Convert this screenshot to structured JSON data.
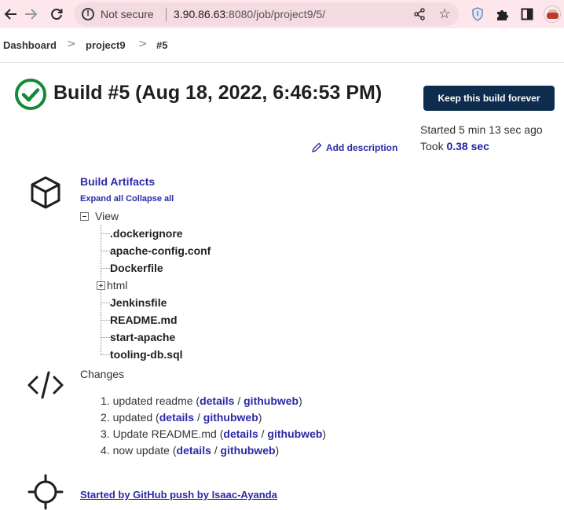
{
  "browser": {
    "security_label": "Not secure",
    "url_host": "3.90.86.63",
    "url_rest": ":8080/job/project9/5/"
  },
  "breadcrumb": {
    "items": [
      "Dashboard",
      "project9",
      "#5"
    ],
    "separator": ">"
  },
  "build": {
    "title": "Build #5 (Aug 18, 2022, 6:46:53 PM)",
    "status": "success",
    "keep_button_label": "Keep this build forever",
    "started_ago": "Started 5 min 13 sec ago",
    "took_label": "Took",
    "took_value": "0.38 sec",
    "add_description_label": "Add description"
  },
  "artifacts": {
    "title": "Build Artifacts",
    "expand_all": "Expand all",
    "collapse_all": "Collapse all",
    "root_label": "View",
    "items": [
      {
        "name": ".dockerignore",
        "type": "file"
      },
      {
        "name": "apache-config.conf",
        "type": "file"
      },
      {
        "name": "Dockerfile",
        "type": "file"
      },
      {
        "name": "html",
        "type": "folder"
      },
      {
        "name": "Jenkinsfile",
        "type": "file"
      },
      {
        "name": "README.md",
        "type": "file"
      },
      {
        "name": "start-apache",
        "type": "file"
      },
      {
        "name": "tooling-db.sql",
        "type": "file"
      }
    ]
  },
  "changes": {
    "title": "Changes",
    "items": [
      {
        "prefix": "1. updated readme (",
        "details": "details",
        "sep": " / ",
        "web": "githubweb",
        "suffix": ")"
      },
      {
        "prefix": "2. updated (",
        "details": "details",
        "sep": " / ",
        "web": "githubweb",
        "suffix": ")"
      },
      {
        "prefix": "3. Update README.md (",
        "details": "details",
        "sep": " / ",
        "web": "githubweb",
        "suffix": ")"
      },
      {
        "prefix": "4. now update (",
        "details": "details",
        "sep": " / ",
        "web": "githubweb",
        "suffix": ")"
      }
    ]
  },
  "cause": {
    "label": "Started by GitHub push by Isaac-Ayanda"
  },
  "colors": {
    "link": "#2a2aa8",
    "success": "#138a36",
    "primary_button": "#0e2d4e",
    "chrome": "#fde6ec"
  },
  "icons": {
    "back": "arrow-left-icon",
    "forward": "arrow-right-icon",
    "reload": "reload-icon",
    "share": "share-icon",
    "bookmark": "star-icon",
    "extension_1": "shield-extension-icon",
    "extensions": "puzzle-icon",
    "side_panel": "side-panel-icon",
    "status": "success-check-icon",
    "artifacts": "package-box-icon",
    "changes": "code-icon",
    "cause": "crosshair-icon",
    "edit": "pencil-icon"
  }
}
